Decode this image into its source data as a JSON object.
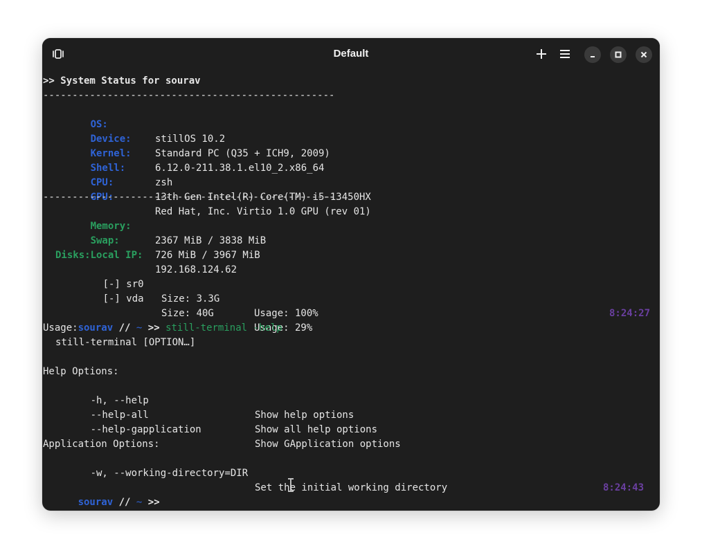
{
  "window": {
    "title": "Default"
  },
  "titlebar": {
    "left_icon": "tab-overview-icon",
    "new_tab_icon": "plus-icon",
    "menu_icon": "hamburger-menu-icon",
    "minimize_icon": "minimize-icon",
    "maximize_icon": "maximize-icon",
    "close_icon": "close-icon"
  },
  "terminal": {
    "header": ">> System Status for sourav",
    "separator": "--------------------------------------------------",
    "system": [
      {
        "key": "OS:",
        "value": "stillOS 10.2"
      },
      {
        "key": "Device:",
        "value": "Standard PC (Q35 + ICH9, 2009)"
      },
      {
        "key": "Kernel:",
        "value": "6.12.0-211.38.1.el10_2.x86_64"
      },
      {
        "key": "Shell:",
        "value": "zsh"
      },
      {
        "key": "CPU:",
        "value": "13th Gen Intel(R) Core(TM) i5-13450HX"
      },
      {
        "key": "GPU:",
        "value": "Red Hat, Inc. Virtio 1.0 GPU (rev 01)"
      }
    ],
    "resources": [
      {
        "key": "Memory:",
        "value": "2367 MiB / 3838 MiB"
      },
      {
        "key": "Swap:",
        "value": "726 MiB / 3967 MiB"
      },
      {
        "key": "Local IP:",
        "value": "192.168.124.62"
      }
    ],
    "disks_label": "Disks:",
    "disks": [
      {
        "name": "[-] sr0",
        "size": "Size: 3.3G",
        "usage": "Usage: 100%"
      },
      {
        "name": "[-] vda",
        "size": "Size: 40G",
        "usage": "Usage: 29%"
      }
    ],
    "prompt1": {
      "user": "sourav",
      "sep": "//",
      "dir": "~",
      "arrows": ">>",
      "command": "still-terminal -help",
      "time": "8:24:27"
    },
    "usage_label": "Usage:",
    "usage_line": "still-terminal [OPTION…]",
    "help_options_label": "Help Options:",
    "help_options": [
      {
        "flag": "-h, --help",
        "desc": "Show help options"
      },
      {
        "flag": "--help-all",
        "desc": "Show all help options"
      },
      {
        "flag": "--help-gapplication",
        "desc": "Show GApplication options"
      }
    ],
    "app_options_label": "Application Options:",
    "app_options": [
      {
        "flag": "-w, --working-directory=DIR",
        "desc": "Set the initial working directory"
      }
    ],
    "prompt2": {
      "user": "sourav",
      "sep": "//",
      "dir": "~",
      "arrows": ">>",
      "time": "8:24:43"
    }
  }
}
